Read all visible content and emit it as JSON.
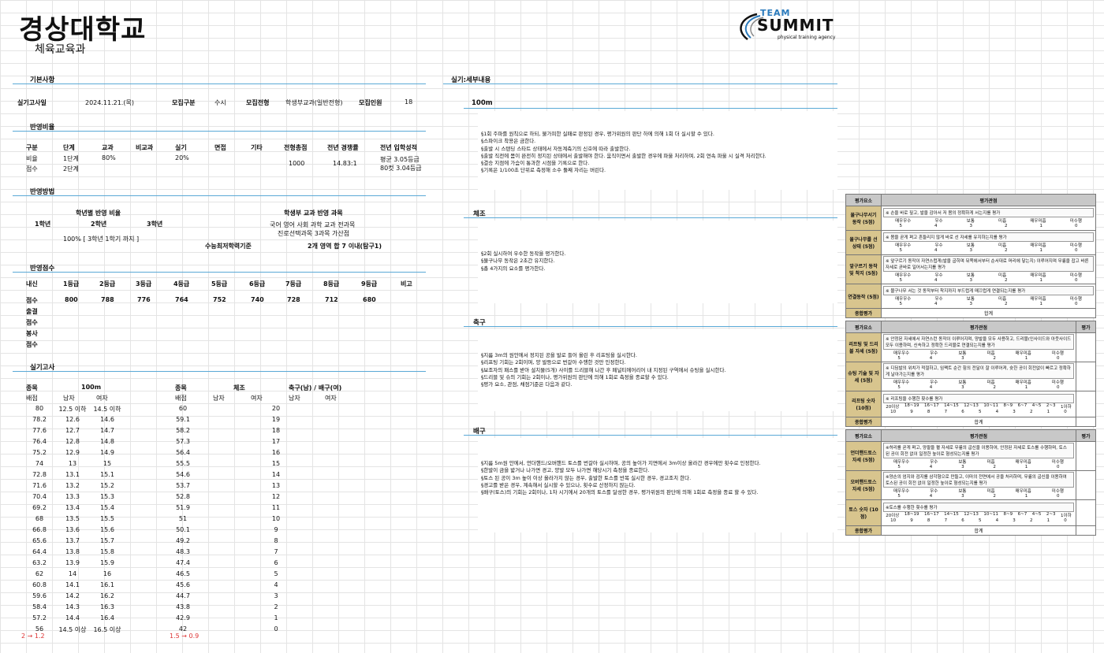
{
  "header": {
    "title": "경상대학교",
    "subtitle": "체육교육과",
    "logo_team": "TEAM",
    "logo_main": "SUMMIT",
    "logo_tag": "physical training agency"
  },
  "basic": {
    "section": "기본사항",
    "date_label": "실기고사일",
    "date_value": "2024.11.21.(목)",
    "type_label": "모집구분",
    "type_value": "수시",
    "track_label": "모집전형",
    "track_value": "학생부교과(일반전형)",
    "count_label": "모집인원",
    "count_value": "18"
  },
  "ratio": {
    "section": "반영비율",
    "headers": [
      "구분",
      "단계",
      "교과",
      "비교과",
      "실기",
      "면접",
      "기타",
      "전형총점",
      "전년 경쟁률",
      "전년 입학성적"
    ],
    "row1": [
      "비율",
      "1단계",
      "80%",
      "",
      "20%"
    ],
    "row2": [
      "점수",
      "2단계"
    ],
    "total": "1000",
    "competition": "14.83:1",
    "admission1": "평균 3.05등급",
    "admission2": "80컷 3.04등급"
  },
  "method": {
    "section": "반영방법",
    "grade_title": "학년별 반영 비율",
    "g1": "1학년",
    "g2": "2학년",
    "g3": "3학년",
    "grade_value": "100% [ 3학년 1학기 까지 ]",
    "subject_title": "학생부 교과 반영 과목",
    "subject_line1": "국어 영어 사회 과학 교과 전과목",
    "subject_line2": "진로선택과목 3과목 가산점",
    "min_label": "수능최저학력기준",
    "min_value": "2개 영역 합 7 이내(탐구1)"
  },
  "score": {
    "section": "반영점수",
    "row_label": "내신",
    "grades": [
      "1등급",
      "2등급",
      "3등급",
      "4등급",
      "5등급",
      "6등급",
      "7등급",
      "8등급",
      "9등급",
      "비고"
    ],
    "points_label": "점수",
    "points": [
      "800",
      "788",
      "776",
      "764",
      "752",
      "740",
      "728",
      "712",
      "680"
    ],
    "rows": [
      "출결",
      "점수",
      "봉사",
      "점수"
    ]
  },
  "practical": {
    "section": "실기고사",
    "item_label": "종목",
    "score_label": "배점",
    "e1": "100m",
    "male": "남자",
    "female": "여자",
    "e2": "체조",
    "e3": "축구(남) / 배구(여)",
    "rows": [
      [
        "80",
        "12.5 이하",
        "14.5 이하",
        "60",
        "20"
      ],
      [
        "78.2",
        "12.6",
        "14.6",
        "59.1",
        "19"
      ],
      [
        "77.6",
        "12.7",
        "14.7",
        "58.2",
        "18"
      ],
      [
        "76.4",
        "12.8",
        "14.8",
        "57.3",
        "17"
      ],
      [
        "75.2",
        "12.9",
        "14.9",
        "56.4",
        "16"
      ],
      [
        "74",
        "13",
        "15",
        "55.5",
        "15"
      ],
      [
        "72.8",
        "13.1",
        "15.1",
        "54.6",
        "14"
      ],
      [
        "71.6",
        "13.2",
        "15.2",
        "53.7",
        "13"
      ],
      [
        "70.4",
        "13.3",
        "15.3",
        "52.8",
        "12"
      ],
      [
        "69.2",
        "13.4",
        "15.4",
        "51.9",
        "11"
      ],
      [
        "68",
        "13.5",
        "15.5",
        "51",
        "10"
      ],
      [
        "66.8",
        "13.6",
        "15.6",
        "50.1",
        "9"
      ],
      [
        "65.6",
        "13.7",
        "15.7",
        "49.2",
        "8"
      ],
      [
        "64.4",
        "13.8",
        "15.8",
        "48.3",
        "7"
      ],
      [
        "63.2",
        "13.9",
        "15.9",
        "47.4",
        "6"
      ],
      [
        "62",
        "14",
        "16",
        "46.5",
        "5"
      ],
      [
        "60.8",
        "14.1",
        "16.1",
        "45.6",
        "4"
      ],
      [
        "59.6",
        "14.2",
        "16.2",
        "44.7",
        "3"
      ],
      [
        "58.4",
        "14.3",
        "16.3",
        "43.8",
        "2"
      ],
      [
        "57.2",
        "14.4",
        "16.4",
        "42.9",
        "1"
      ],
      [
        "56",
        "14.5 이상",
        "16.5 이상",
        "42",
        "0"
      ]
    ],
    "note1": "2 → 1.2",
    "note2": "1.5 → 0.9"
  },
  "detail": {
    "section": "실기:세부내용",
    "e100": {
      "name": "100m",
      "lines": [
        "§1회 주파를 원칙으로 하되, 불가피한 실패로 판정된 경우, 평가위원의 판단 하에 의해 1회 더 실시할 수 있다.",
        "§스파이크 착용은 금한다.",
        "§출발 시 스탠딩 스타트 상태에서 자동계측기의 신호에 따라 출발한다.",
        "§출발 직전에 몸이 완전히 정지된 상태에서 출발해야 한다. 움직이면서 출발한 경우에 파울 처리하며, 2회 연속 파울 시 실격 처리한다.",
        "§결승 지점에 가슴이 통과한 시점을 기록으로 한다.",
        "§기록은 1/100초 단위로 측정해 소수 둘째 자리는 버린다."
      ]
    },
    "gym": {
      "name": "체조",
      "lines": [
        "§2회 실시하여 우수한 동작을 평가한다.",
        "§물구나무 동작은 2초간 유지한다.",
        "§총 4가지의 요소를 평가한다."
      ]
    },
    "soccer": {
      "name": "축구",
      "lines": [
        "§지름 3m의 원안에서 정지된 공을 발로 들어 올린 후 리프팅을 실시한다.",
        "§리프팅 기회는 2회이며, 양 발등으로 번갈아 수행한 것만 인정한다.",
        "§보조자의 패스를 받아 설치물(5개) 사이를 드리블해 나간 후 페널티에어리어 내 지정된 구역에서 슈팅을 실시한다.",
        "§드리블 및 슈의 기회는 2회이나, 평가위원의 판단에 의해 1회로 측정을 종료할 수 있다.",
        "§평가 요소, 관점, 채점기준은 다음과 같다."
      ]
    },
    "volley": {
      "name": "배구",
      "lines": [
        "§지름 5m원 안에서, 언더핸드/오버핸드 토스를 번갈아 실시하며, 공의 높이가 지면에서 3m이상 올라간 경우에만 횟수로 인정한다.",
        "§한발이 금을 밟거나 나가면 경고, 양발 모두 나가면 해당시기 측정을 종료한다.",
        "§토스 된 공이 3m 높이 이상 올라가지 않는 경우, 출발한 토스를 반복 실시한 경우, 경고조치 한다.",
        "§경고를 받은 경우, 계속해서 실시할 수 있으나, 횟수로 산정하지 않는다.",
        "§배구(토스)의 기회는 2회이나, 1차 시기에서 20개의 토스를 달성한 경우, 평가위원의 판단에 의해 1회로 측정을 종료 할 수 있다."
      ]
    }
  },
  "eval": {
    "h1": "평가요소",
    "h2": "평가관점",
    "h3": "평가",
    "total": "종합평가",
    "sum": "합계",
    "g5": [
      "매우우수",
      "우수",
      "보통",
      "미흡",
      "매우미흡",
      "미수행"
    ],
    "p5": [
      "5",
      "4",
      "3",
      "2",
      "1",
      "0"
    ],
    "gym": [
      {
        "name": "물구나무서기 동작 (5점)",
        "crit": "※ 손을 바로 짚고, 발을 감아서 저 몸의 정확하게 서는지를 평가"
      },
      {
        "name": "물구나무를 선 상태 (5점)",
        "crit": "※ 몸을 곧게 펴고 흔들리지 않게 바로 선 자세를 유지하는지를 평가"
      },
      {
        "name": "앞구르기 동작 및 착지 (5점)",
        "crit": "※ 앞구르기 동작이 자연스럽게(발을 굽히며 뒤쪽에서부터 순서대로 머리에 닿는지) 이루어지며 무릎을 잡고 바른 자세로 곧바로 일어서는지를 평가"
      },
      {
        "name": "연결동작 (5점)",
        "crit": "※ 물구나무 서는 것 동작부터 착지까지 부드럽게 매끄럽게 연결되는지를 평가"
      }
    ],
    "soccer": [
      {
        "name": "리프팅 및 드리블 자세 (5점)",
        "crit": "※ 안정된 자세에서 자연스런 동작이 이루어지며, 양발을 모두 사용하고, 드리블(인사이드와 아웃사이드 모두 이용하며, 신속하고 정확한 드리블로 연결되는지를 평가"
      },
      {
        "name": "슈팅 기술 및 자세 (5점)",
        "crit": "※ 디딤발의 위치가 적절하고, 임팩트 순간 힘의 전달이 잘 이루어져, 슛한 공이 회전없이 빠르고 정확하게 날아가는지를 평가"
      }
    ],
    "soccer_count": {
      "name": "리프팅 숫자 (10점)",
      "crit": "※ 리프팅을 수행한 횟수를 평가",
      "ranges": [
        "20이상",
        "18~19",
        "16~17",
        "14~15",
        "12~13",
        "10~11",
        "8~9",
        "6~7",
        "4~5",
        "2~3",
        "1이하"
      ],
      "pts": [
        "10",
        "9",
        "8",
        "7",
        "6",
        "5",
        "4",
        "3",
        "2",
        "1",
        "0"
      ]
    },
    "volley": [
      {
        "name": "언더핸드토스 자세 (5점)",
        "crit": "※허리를 곧게 펴고, 양팔을 펼 자세로 무릎의 굽신을 이용하여, 안정된 자세로 토스를 수행하며, 토스 된 공이 회전 없이 일정한 높이로 형성되는지를 평가"
      },
      {
        "name": "오버핸드토스 자세 (5점)",
        "crit": "※양손의 엄지와 검지를 삼각형으로 만들고, 이마의 전면에서 공을 처리하며, 무릎의 굽신을 이용하여 토스된 공이 회전 없이 일정한 높이로 형성되는지를 평가"
      }
    ],
    "volley_count": {
      "name": "토스 숫자 (10점)",
      "crit": "※토스를 수행한 횟수를 평가",
      "ranges": [
        "20이상",
        "18~19",
        "16~17",
        "14~15",
        "12~13",
        "10~11",
        "8~9",
        "6~7",
        "4~5",
        "2~3",
        "1이하"
      ],
      "pts": [
        "10",
        "9",
        "8",
        "7",
        "6",
        "5",
        "4",
        "3",
        "2",
        "1",
        "0"
      ]
    }
  }
}
